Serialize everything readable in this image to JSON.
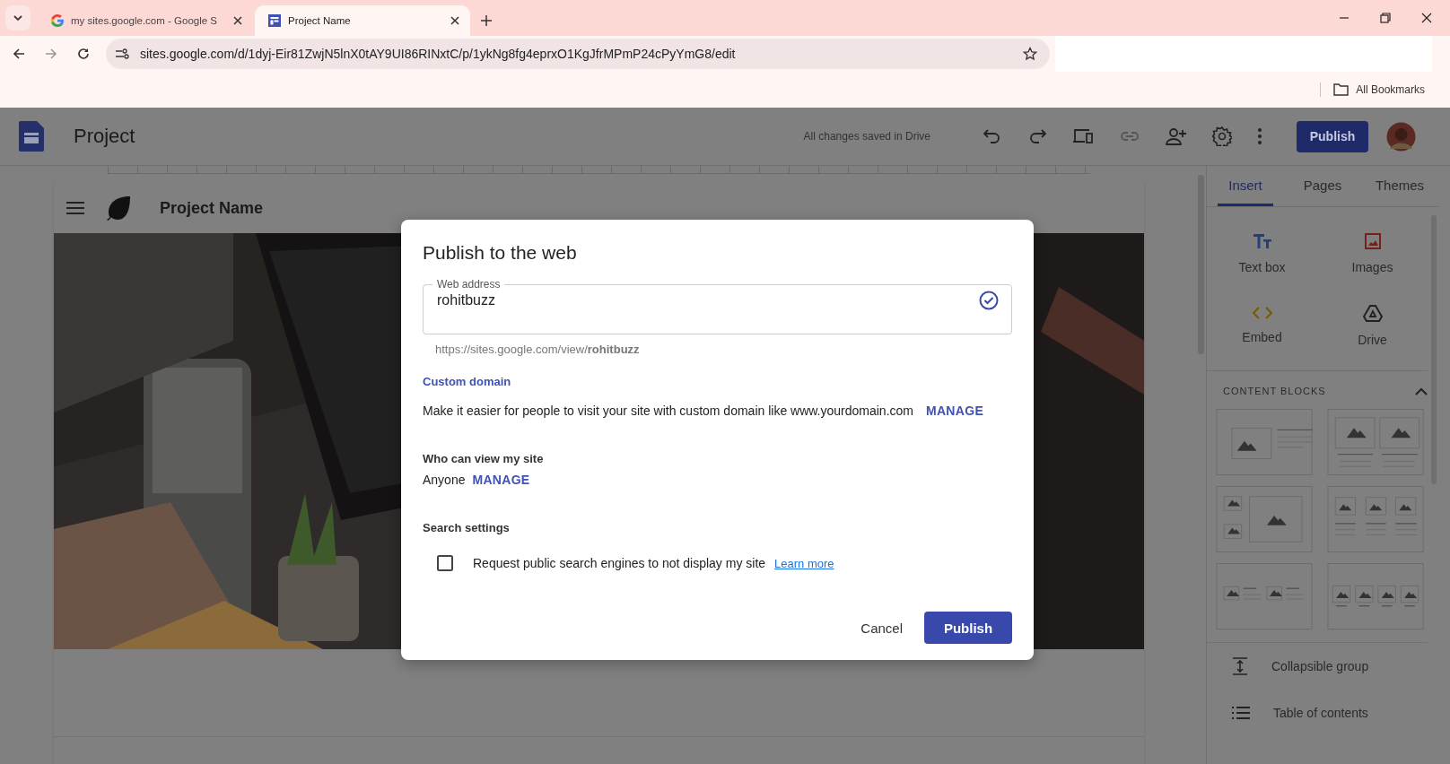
{
  "browser": {
    "tabs": [
      {
        "title": "my sites.google.com - Google S",
        "kind": "google",
        "selected": false
      },
      {
        "title": "Project Name",
        "kind": "sites",
        "selected": true
      }
    ],
    "address": "sites.google.com/d/1dyj-Eir81ZwjN5lnX0tAY9UI86RINxtC/p/1ykNg8fg4eprxO1KgJfrMPmP24cPyYmG8/edit",
    "bookmarks": "All Bookmarks"
  },
  "editor": {
    "title": "Project",
    "status": "All changes saved in Drive",
    "publish": "Publish"
  },
  "site": {
    "title": "Project Name"
  },
  "side_panel": {
    "tabs": [
      {
        "label": "Insert",
        "selected": true
      },
      {
        "label": "Pages",
        "selected": false
      },
      {
        "label": "Themes",
        "selected": false
      }
    ],
    "insert_items": [
      {
        "label": "Text box",
        "kind": "textbox"
      },
      {
        "label": "Images",
        "kind": "images"
      },
      {
        "label": "Embed",
        "kind": "embed"
      },
      {
        "label": "Drive",
        "kind": "drive"
      }
    ],
    "content_blocks": {
      "heading": "CONTENT BLOCKS",
      "expanded": true
    },
    "extra_items": [
      {
        "label": "Collapsible group",
        "kind": "collapsible"
      },
      {
        "label": "Table of contents",
        "kind": "toc"
      }
    ]
  },
  "dialog": {
    "title": "Publish to the web",
    "field_label": "Web address",
    "value": "rohitbuzz",
    "valid": true,
    "url": "https://sites.google.com/view/**rohitbuzz**",
    "custom_domain": {
      "heading": "Custom domain",
      "text": "Make it easier for people to visit your site with custom domain like www.yourdomain.com",
      "action": "MANAGE"
    },
    "visibility": {
      "heading": "Who can view my site",
      "value": "Anyone",
      "action": "MANAGE"
    },
    "search": {
      "heading": "Search settings",
      "label": "Request public search engines to not display my site",
      "checked": false,
      "link": "Learn more"
    },
    "buttons": {
      "cancel": "Cancel",
      "publish": "Publish"
    }
  }
}
